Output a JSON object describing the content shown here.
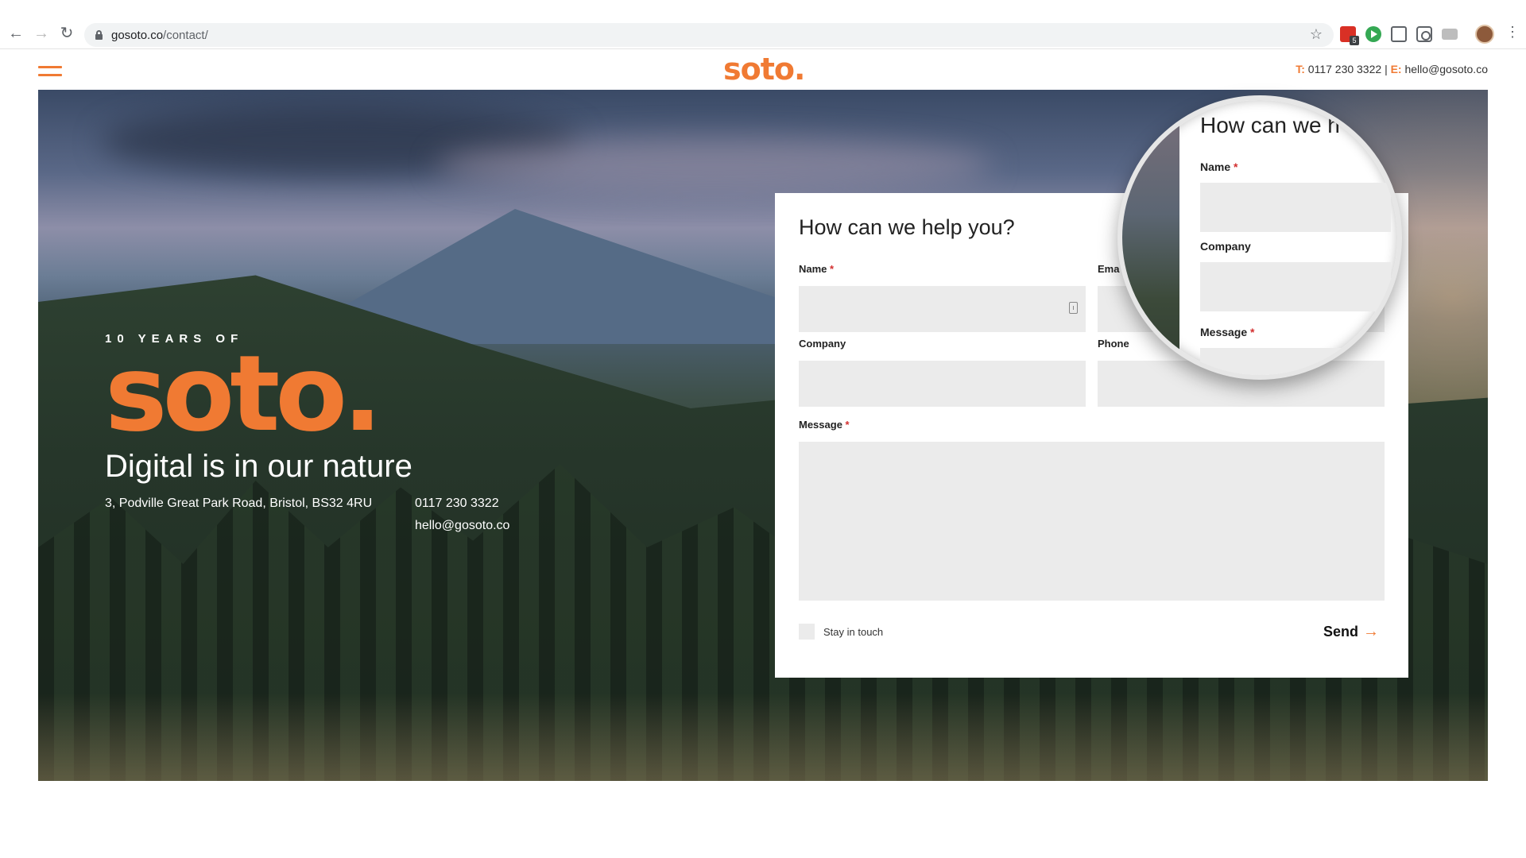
{
  "browser": {
    "url_host": "gosoto.co",
    "url_path": "/contact/",
    "ext_badge": "5"
  },
  "header": {
    "logo": "soto.",
    "phone_label": "T:",
    "phone": "0117 230 3322",
    "separator": "|",
    "email_label": "E:",
    "email": "hello@gosoto.co"
  },
  "hero": {
    "years_label": "10 YEARS OF",
    "logo": "soto.",
    "tagline": "Digital is in our nature",
    "address": "3, Podville Great Park Road, Bristol, BS32 4RU",
    "phone": "0117 230 3322",
    "email": "hello@gosoto.co"
  },
  "form": {
    "title": "How can we help you?",
    "name_label": "Name",
    "email_label": "Ema",
    "company_label": "Company",
    "phone_label": "Phone",
    "message_label": "Message",
    "required_mark": "*",
    "stay_in_touch": "Stay in touch",
    "send_label": "Send",
    "send_arrow": "→"
  },
  "magnifier": {
    "title": "How can we h",
    "name_label": "Name",
    "company_label": "Company",
    "message_label": "Message",
    "required_mark": "*"
  },
  "colors": {
    "brand_orange": "#f07a33",
    "field_bg": "#ebebeb",
    "required_red": "#d32f2f"
  },
  "icons": [
    "back-arrow-icon",
    "forward-arrow-icon",
    "reload-icon",
    "lock-icon",
    "star-icon",
    "menu-icon",
    "password-key-icon",
    "send-arrow-icon"
  ]
}
